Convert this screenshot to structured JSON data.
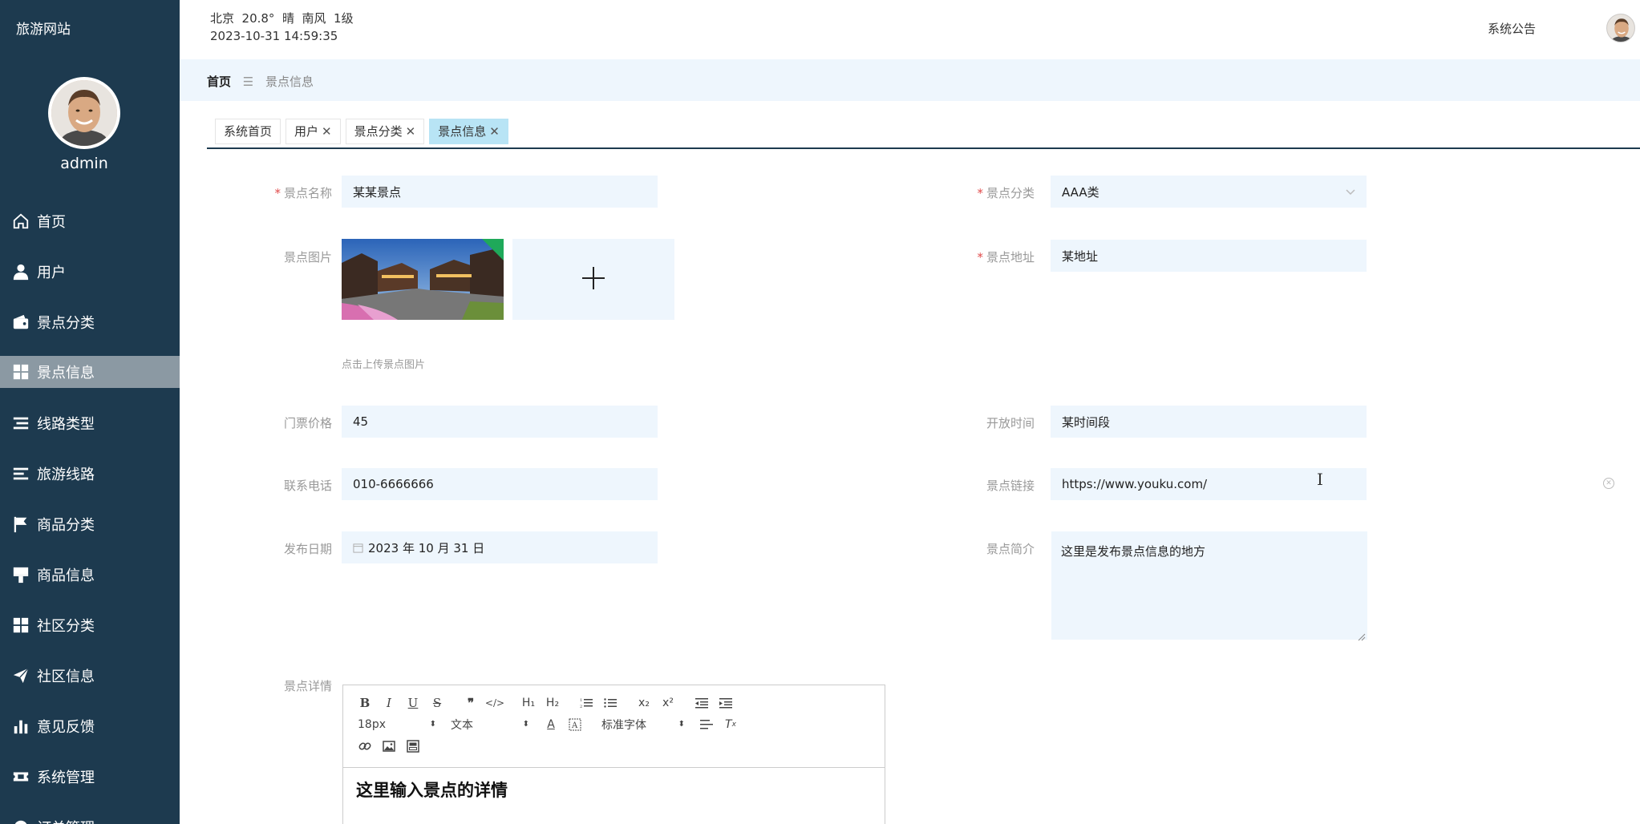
{
  "sidebar": {
    "site_title": "旅游网站",
    "username": "admin",
    "items": [
      {
        "label": "首页",
        "icon": "home-icon"
      },
      {
        "label": "用户",
        "icon": "user-icon"
      },
      {
        "label": "景点分类",
        "icon": "wallet-icon"
      },
      {
        "label": "景点信息",
        "icon": "grid-icon",
        "active": true
      },
      {
        "label": "线路类型",
        "icon": "list-icon"
      },
      {
        "label": "旅游线路",
        "icon": "list-alt-icon"
      },
      {
        "label": "商品分类",
        "icon": "flag-icon"
      },
      {
        "label": "商品信息",
        "icon": "brush-icon"
      },
      {
        "label": "社区分类",
        "icon": "grid-icon"
      },
      {
        "label": "社区信息",
        "icon": "paper-plane-icon"
      },
      {
        "label": "意见反馈",
        "icon": "bar-chart-icon"
      },
      {
        "label": "系统管理",
        "icon": "ticket-icon"
      },
      {
        "label": "订单管理",
        "icon": "circle-icon"
      }
    ]
  },
  "header": {
    "weather_line": "北京  20.8°  晴  南风  1级",
    "datetime": "2023-10-31 14:59:35",
    "notice": "系统公告"
  },
  "breadcrumb": {
    "home": "首页",
    "separator": "☰",
    "current": "景点信息"
  },
  "tabs": [
    {
      "label": "系统首页",
      "closable": false
    },
    {
      "label": "用户",
      "closable": true
    },
    {
      "label": "景点分类",
      "closable": true
    },
    {
      "label": "景点信息",
      "closable": true,
      "active": true
    }
  ],
  "form": {
    "name_label": "景点名称",
    "name_value": "某某景点",
    "category_label": "景点分类",
    "category_value": "AAA类",
    "image_label": "景点图片",
    "upload_hint": "点击上传景点图片",
    "address_label": "景点地址",
    "address_value": "某地址",
    "price_label": "门票价格",
    "price_value": "45",
    "open_time_label": "开放时间",
    "open_time_value": "某时间段",
    "phone_label": "联系电话",
    "phone_value": "010-6666666",
    "link_label": "景点链接",
    "link_value": "https://www.youku.com/",
    "date_label": "发布日期",
    "date_value": "2023 年 10 月 31 日",
    "intro_label": "景点简介",
    "intro_value": "这里是发布景点信息的地方",
    "detail_label": "景点详情",
    "detail_value": "这里输入景点的详情"
  },
  "editor": {
    "font_size": "18px",
    "block_type": "文本",
    "font_family": "标准字体"
  },
  "colors": {
    "sidebar_bg": "#1d3a4f",
    "active_menu_bg": "#8b99a3",
    "input_bg": "#eef6fd",
    "active_tab_bg": "#b8e4f5",
    "required_star": "#e14b4b"
  }
}
